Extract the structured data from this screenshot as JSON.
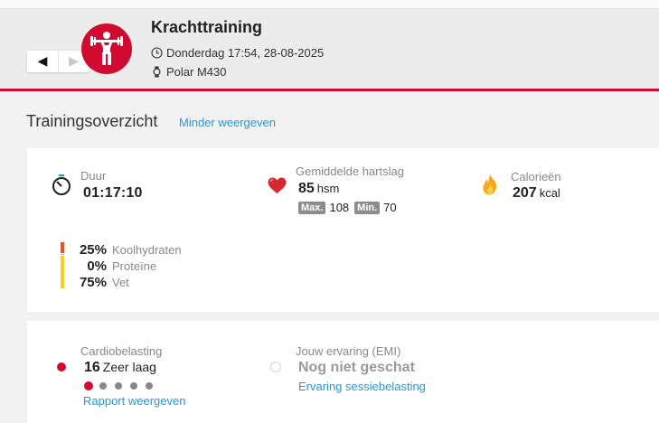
{
  "header": {
    "title": "Krachttraining",
    "datetime": "Donderdag 17:54, 28-08-2025",
    "device": "Polar M430",
    "nav_prev": "◀",
    "nav_next": "▶",
    "sport_icon": "strength-training-icon",
    "accent_color": "#d10a30"
  },
  "overview": {
    "title": "Trainingsoverzicht",
    "toggle_link": "Minder weergeven"
  },
  "summary": {
    "duration": {
      "label": "Duur",
      "value": "01:17:10",
      "icon": "stopwatch-icon"
    },
    "heart_rate": {
      "label": "Gemiddelde hartslag",
      "value": "85",
      "unit": "hsm",
      "max_label": "Max.",
      "max_value": "108",
      "min_label": "Min.",
      "min_value": "70",
      "icon": "heart-icon"
    },
    "calories": {
      "label": "Calorieën",
      "value": "207",
      "unit": "kcal",
      "icon": "flame-icon"
    },
    "macros": [
      {
        "pct": "25%",
        "label": "Koolhydraten",
        "color": "#e8532a"
      },
      {
        "pct": "0%",
        "label": "Proteïne",
        "color": "#f5a623"
      },
      {
        "pct": "75%",
        "label": "Vet",
        "color": "#f2d21b"
      }
    ]
  },
  "load": {
    "cardio": {
      "label": "Cardiobelasting",
      "value": "16",
      "level": "Zeer laag",
      "link": "Rapport weergeven",
      "level_index": 1,
      "level_count": 5,
      "active_color": "#d10a30"
    },
    "emi": {
      "label": "Jouw ervaring (EMI)",
      "value": "Nog niet geschat",
      "link": "Ervaring sessiebelasting"
    }
  }
}
